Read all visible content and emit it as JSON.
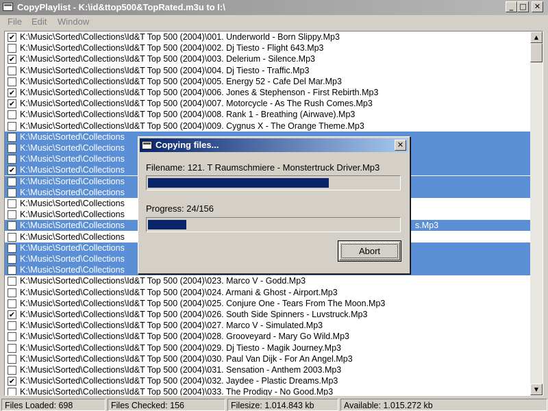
{
  "window": {
    "title": "CopyPlaylist - K:\\id&ttop500&TopRated.m3u to I:\\",
    "icon": "app-window-icon",
    "controls": {
      "minimize": "_",
      "maximize": "□",
      "close": "✕"
    }
  },
  "menu": {
    "items": [
      "File",
      "Edit",
      "Window"
    ]
  },
  "list": {
    "rows": [
      {
        "checked": true,
        "selected": false,
        "text": "K:\\Music\\Sorted\\Collections\\Id&T Top 500 (2004)\\001. Underworld - Born Slippy.Mp3"
      },
      {
        "checked": false,
        "selected": false,
        "text": "K:\\Music\\Sorted\\Collections\\Id&T Top 500 (2004)\\002. Dj Tiesto - Flight 643.Mp3"
      },
      {
        "checked": true,
        "selected": false,
        "text": "K:\\Music\\Sorted\\Collections\\Id&T Top 500 (2004)\\003. Delerium - Silence.Mp3"
      },
      {
        "checked": false,
        "selected": false,
        "text": "K:\\Music\\Sorted\\Collections\\Id&T Top 500 (2004)\\004. Dj Tiesto - Traffic.Mp3"
      },
      {
        "checked": false,
        "selected": false,
        "text": "K:\\Music\\Sorted\\Collections\\Id&T Top 500 (2004)\\005. Energy 52 - Cafe Del Mar.Mp3"
      },
      {
        "checked": true,
        "selected": false,
        "text": "K:\\Music\\Sorted\\Collections\\Id&T Top 500 (2004)\\006. Jones & Stephenson - First Rebirth.Mp3"
      },
      {
        "checked": true,
        "selected": false,
        "text": "K:\\Music\\Sorted\\Collections\\Id&T Top 500 (2004)\\007. Motorcycle - As The Rush Comes.Mp3"
      },
      {
        "checked": false,
        "selected": false,
        "text": "K:\\Music\\Sorted\\Collections\\Id&T Top 500 (2004)\\008. Rank 1 - Breathing (Airwave).Mp3"
      },
      {
        "checked": false,
        "selected": false,
        "text": "K:\\Music\\Sorted\\Collections\\Id&T Top 500 (2004)\\009. Cygnus X - The Orange Theme.Mp3"
      },
      {
        "checked": false,
        "selected": true,
        "text": "K:\\Music\\Sorted\\Collections"
      },
      {
        "checked": false,
        "selected": true,
        "text": "K:\\Music\\Sorted\\Collections"
      },
      {
        "checked": false,
        "selected": true,
        "text": "K:\\Music\\Sorted\\Collections"
      },
      {
        "checked": true,
        "selected": true,
        "text": "K:\\Music\\Sorted\\Collections"
      },
      {
        "checked": false,
        "selected": true,
        "text": "K:\\Music\\Sorted\\Collections"
      },
      {
        "checked": false,
        "selected": true,
        "text": "K:\\Music\\Sorted\\Collections"
      },
      {
        "checked": false,
        "selected": false,
        "text": "K:\\Music\\Sorted\\Collections"
      },
      {
        "checked": false,
        "selected": false,
        "text": "K:\\Music\\Sorted\\Collections"
      },
      {
        "checked": false,
        "selected": true,
        "text": "K:\\Music\\Sorted\\Collections"
      },
      {
        "checked": false,
        "selected": false,
        "text": "K:\\Music\\Sorted\\Collections"
      },
      {
        "checked": false,
        "selected": true,
        "text": "K:\\Music\\Sorted\\Collections"
      },
      {
        "checked": false,
        "selected": true,
        "text": "K:\\Music\\Sorted\\Collections"
      },
      {
        "checked": false,
        "selected": true,
        "text": "K:\\Music\\Sorted\\Collections"
      },
      {
        "checked": false,
        "selected": false,
        "text": "K:\\Music\\Sorted\\Collections\\Id&T Top 500 (2004)\\023. Marco V - Godd.Mp3"
      },
      {
        "checked": false,
        "selected": false,
        "text": "K:\\Music\\Sorted\\Collections\\Id&T Top 500 (2004)\\024. Armani & Ghost - Airport.Mp3"
      },
      {
        "checked": false,
        "selected": false,
        "text": "K:\\Music\\Sorted\\Collections\\Id&T Top 500 (2004)\\025. Conjure One - Tears From The Moon.Mp3"
      },
      {
        "checked": true,
        "selected": false,
        "text": "K:\\Music\\Sorted\\Collections\\Id&T Top 500 (2004)\\026. South Side Spinners - Luvstruck.Mp3"
      },
      {
        "checked": false,
        "selected": false,
        "text": "K:\\Music\\Sorted\\Collections\\Id&T Top 500 (2004)\\027. Marco V - Simulated.Mp3"
      },
      {
        "checked": false,
        "selected": false,
        "text": "K:\\Music\\Sorted\\Collections\\Id&T Top 500 (2004)\\028. Grooveyard - Mary Go Wild.Mp3"
      },
      {
        "checked": false,
        "selected": false,
        "text": "K:\\Music\\Sorted\\Collections\\Id&T Top 500 (2004)\\029. Dj Tiesto - Magik Journey.Mp3"
      },
      {
        "checked": false,
        "selected": false,
        "text": "K:\\Music\\Sorted\\Collections\\Id&T Top 500 (2004)\\030. Paul Van Dijk - For An Angel.Mp3"
      },
      {
        "checked": false,
        "selected": false,
        "text": "K:\\Music\\Sorted\\Collections\\Id&T Top 500 (2004)\\031. Sensation - Anthem 2003.Mp3"
      },
      {
        "checked": true,
        "selected": false,
        "text": "K:\\Music\\Sorted\\Collections\\Id&T Top 500 (2004)\\032. Jaydee - Plastic Dreams.Mp3"
      },
      {
        "checked": false,
        "selected": false,
        "text": "K:\\Music\\Sorted\\Collections\\Id&T Top 500 (2004)\\033. The Prodigy - No Good.Mp3"
      }
    ],
    "partial_suffix": "s.Mp3"
  },
  "scrollbar": {
    "up": "▲",
    "down": "▼"
  },
  "dialog": {
    "title": "Copying files...",
    "filename_label": "Filename: 121. T Raumschmiere - Monstertruck Driver.Mp3",
    "file_progress": 0.72,
    "progress_label": "Progress: 24/156",
    "total_progress": 0.154,
    "abort_label": "Abort",
    "close": "✕"
  },
  "status": {
    "files_loaded": "Files Loaded: 698",
    "files_checked": "Files Checked: 156",
    "filesize": "Filesize: 1.014.843 kb",
    "available": "Available: 1.015.272 kb"
  },
  "colors": {
    "selection": "#5a8fd6",
    "progress": "#0a246a",
    "face": "#d4d0c8"
  }
}
